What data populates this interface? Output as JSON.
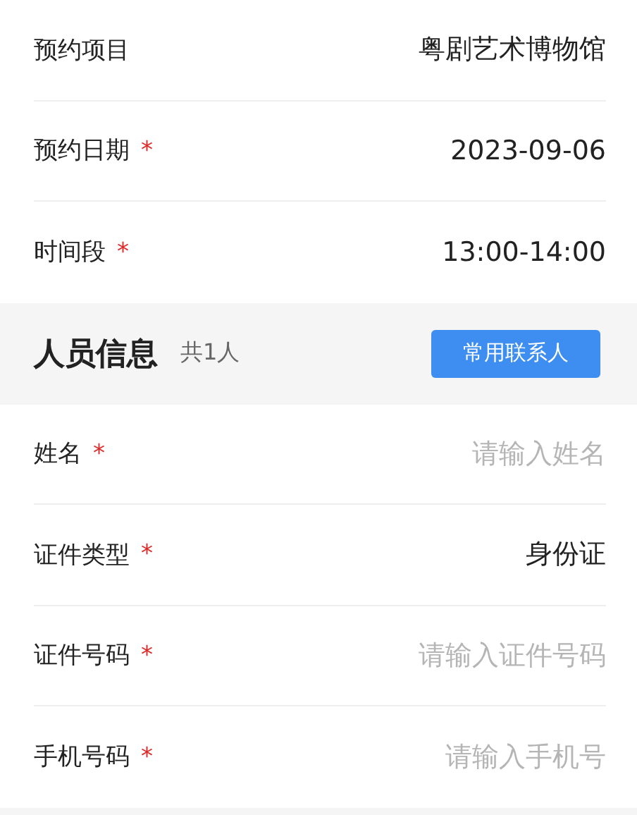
{
  "booking_rows": [
    {
      "kind": "value",
      "label": "预约项目",
      "value": "粤剧艺术博物馆"
    },
    {
      "kind": "value",
      "label": "预约日期",
      "required_mark": "*",
      "value": "2023-09-06"
    },
    {
      "kind": "value",
      "label": "时间段",
      "required_mark": "*",
      "value": "13:00-14:00"
    }
  ],
  "section": {
    "title": "人员信息",
    "count": "共1人",
    "button": "常用联系人"
  },
  "person_rows": [
    {
      "kind": "input",
      "label": "姓名",
      "required_mark": "*",
      "placeholder": "请输入姓名"
    },
    {
      "kind": "value",
      "label": "证件类型",
      "required_mark": "*",
      "value": "身份证"
    },
    {
      "kind": "input",
      "label": "证件号码",
      "required_mark": "*",
      "placeholder": "请输入证件号码"
    },
    {
      "kind": "input",
      "label": "手机号码",
      "required_mark": "*",
      "placeholder": "请输入手机号"
    }
  ]
}
